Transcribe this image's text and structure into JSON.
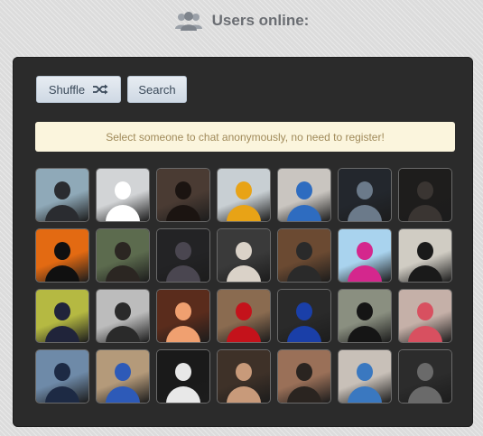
{
  "header": {
    "title": "Users online:",
    "icon": "users-icon"
  },
  "buttons": {
    "shuffle_label": "Shuffle",
    "search_label": "Search"
  },
  "notice": {
    "text": "Select someone to chat anonymously, no need to register!"
  },
  "colors": {
    "panel": "#2b2b2b",
    "notice_bg": "#fbf5dd",
    "notice_text": "#a08a5a",
    "title": "#6b6e73"
  },
  "users": [
    {
      "bg": "#8fa9b8",
      "fg": "#2a2c30"
    },
    {
      "bg": "#d2d4d6",
      "fg": "#ffffff"
    },
    {
      "bg": "#4a3b33",
      "fg": "#1b1411"
    },
    {
      "bg": "#c8cfd3",
      "fg": "#e8a316"
    },
    {
      "bg": "#c9c5c0",
      "fg": "#2e6cc0"
    },
    {
      "bg": "#23272d",
      "fg": "#6b7a8a"
    },
    {
      "bg": "#1e1d1c",
      "fg": "#3a3532"
    },
    {
      "bg": "#e36a12",
      "fg": "#101010"
    },
    {
      "bg": "#5c6b4e",
      "fg": "#2b2622"
    },
    {
      "bg": "#232325",
      "fg": "#4a4650"
    },
    {
      "bg": "#3a3a3a",
      "fg": "#dad2c8"
    },
    {
      "bg": "#6b4a32",
      "fg": "#2a2a2a"
    },
    {
      "bg": "#a9d3ee",
      "fg": "#d4278d"
    },
    {
      "bg": "#d0ccc3",
      "fg": "#1a1a1a"
    },
    {
      "bg": "#b5b942",
      "fg": "#20243a"
    },
    {
      "bg": "#bcbcbc",
      "fg": "#2a2a2a"
    },
    {
      "bg": "#5a2c1c",
      "fg": "#f0a070"
    },
    {
      "bg": "#8a6b50",
      "fg": "#c4121b"
    },
    {
      "bg": "#2a2a2a",
      "fg": "#1a3fa8"
    },
    {
      "bg": "#8a8f80",
      "fg": "#151515"
    },
    {
      "bg": "#c5b0a8",
      "fg": "#d85060"
    },
    {
      "bg": "#6e8aa8",
      "fg": "#1d2a44"
    },
    {
      "bg": "#b49a7a",
      "fg": "#2d5ab8"
    },
    {
      "bg": "#1a1a1a",
      "fg": "#e8e8e8"
    },
    {
      "bg": "#3e3128",
      "fg": "#c89a7a"
    },
    {
      "bg": "#9a7058",
      "fg": "#2a2420"
    },
    {
      "bg": "#c8c0b8",
      "fg": "#3a78c0"
    },
    {
      "bg": "#2c2c2c",
      "fg": "#6a6a6a"
    }
  ]
}
